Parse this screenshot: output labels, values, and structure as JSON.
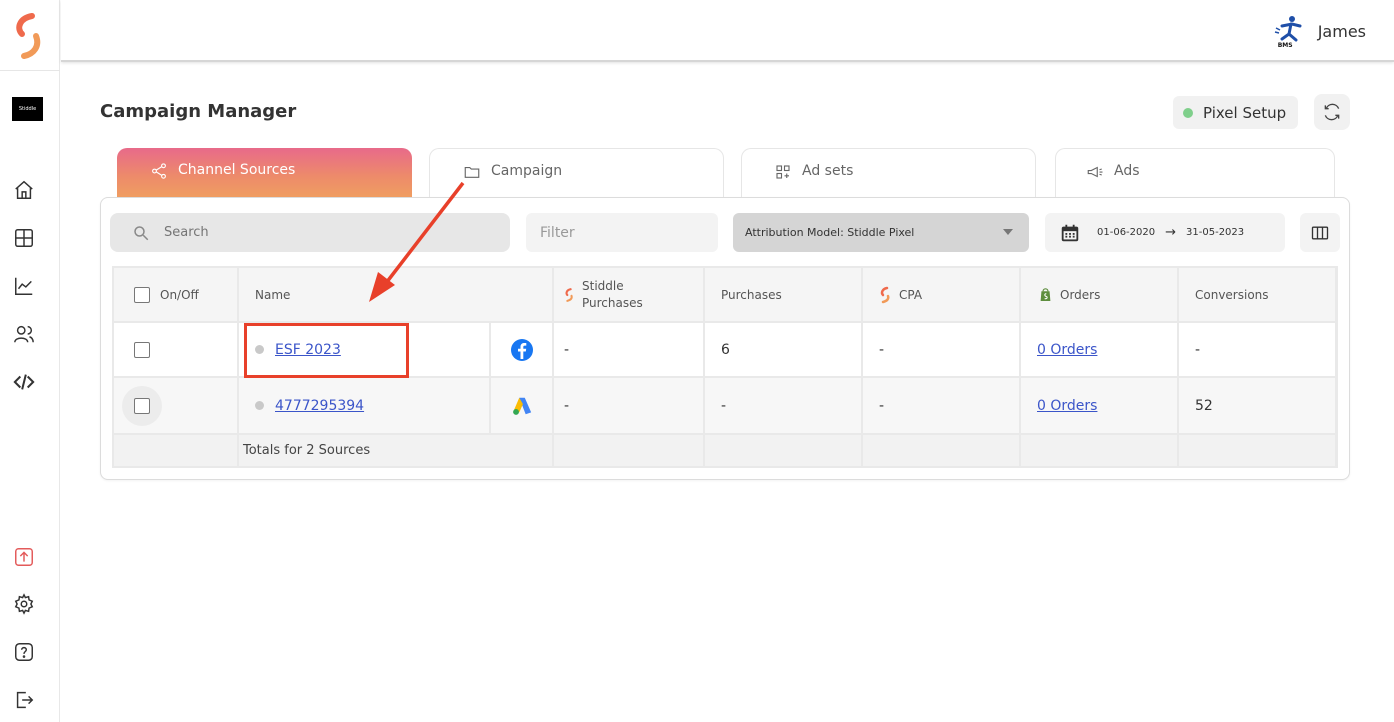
{
  "brand": {
    "tile_text": "Stiddle"
  },
  "user": {
    "name": "James",
    "org": "BMS"
  },
  "page": {
    "title": "Campaign Manager"
  },
  "pixel": {
    "label": "Pixel Setup",
    "status_color": "#7fcf8b"
  },
  "tabs": [
    {
      "label": "Channel Sources",
      "icon": "share-icon",
      "active": true
    },
    {
      "label": "Campaign",
      "icon": "folder-icon",
      "active": false
    },
    {
      "label": "Ad sets",
      "icon": "grid-plus-icon",
      "active": false
    },
    {
      "label": "Ads",
      "icon": "megaphone-icon",
      "active": false
    }
  ],
  "toolbar": {
    "search_placeholder": "Search",
    "filter_placeholder": "Filter",
    "attribution_label": "Attribution Model: Stiddle Pixel",
    "date_from": "01-06-2020",
    "date_arrow": "→",
    "date_to": "31-05-2023"
  },
  "table": {
    "headers": {
      "onoff": "On/Off",
      "name": "Name",
      "stiddle_purchases": "Stiddle Purchases",
      "purchases": "Purchases",
      "cpa": "CPA",
      "orders": "Orders",
      "conversions": "Conversions"
    },
    "rows": [
      {
        "name": "ESF 2023",
        "platform": "facebook-icon",
        "stiddle_purchases": "-",
        "purchases": "6",
        "cpa": "-",
        "orders": "0 Orders",
        "conversions": "-"
      },
      {
        "name": "4777295394",
        "platform": "google-ads-icon",
        "stiddle_purchases": "-",
        "purchases": "-",
        "cpa": "-",
        "orders": "0 Orders",
        "conversions": "52"
      }
    ],
    "footer": "Totals for 2 Sources"
  },
  "colors": {
    "accent": "#ee7a55",
    "link": "#3b55c9",
    "annotation": "#e8402a"
  }
}
